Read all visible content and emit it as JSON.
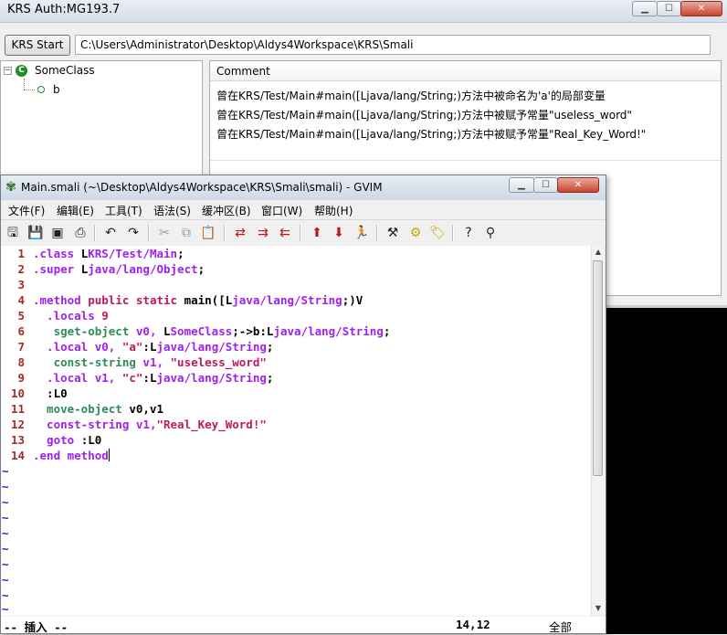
{
  "window": {
    "title": "KRS Auth:MG193.7"
  },
  "toolbar": {
    "start_label": "KRS Start",
    "path_value": "C:\\Users\\Administrator\\Desktop\\Aldys4Workspace\\KRS\\Smali"
  },
  "tree": {
    "class_icon_glyph": "C",
    "class_name": "SomeClass",
    "field_name": "b"
  },
  "comments": {
    "header": "Comment",
    "rows": [
      "曾在KRS/Test/Main#main([Ljava/lang/String;)方法中被命名为'a'的局部变量",
      "曾在KRS/Test/Main#main([Ljava/lang/String;)方法中被赋予常量\"useless_word\"",
      "曾在KRS/Test/Main#main([Ljava/lang/String;)方法中被赋予常量\"Real_Key_Word!\""
    ]
  },
  "gvim": {
    "title": "Main.smali (~\\Desktop\\Aldys4Workspace\\KRS\\Smali\\smali) - GVIM",
    "menu": [
      "文件(F)",
      "编辑(E)",
      "工具(T)",
      "语法(S)",
      "缓冲区(B)",
      "窗口(W)",
      "帮助(H)"
    ],
    "toolbar_icons": [
      "open-icon",
      "save-icon",
      "save-all-icon",
      "print-icon",
      "undo-icon",
      "redo-icon",
      "cut-icon",
      "copy-icon",
      "paste-icon",
      "find-replace-icon",
      "find-next-icon",
      "find-prev-icon",
      "load-session-icon",
      "save-session-icon",
      "run-script-icon",
      "make-icon",
      "run-ctags-icon",
      "jump-tag-icon",
      "help-icon",
      "find-help-icon"
    ],
    "line_numbers": [
      "1",
      "2",
      "3",
      "4",
      "5",
      "6",
      "7",
      "8",
      "9",
      "10",
      "11",
      "12",
      "13",
      "14"
    ],
    "code": {
      "l1": [
        ".class ",
        "L",
        "KRS/Test/Main",
        ";"
      ],
      "l2": [
        ".super ",
        "L",
        "java/lang/Object",
        ";"
      ],
      "l4": [
        ".method ",
        "public static ",
        "main([",
        "L",
        "java/lang/String",
        ";)V"
      ],
      "l5": [
        "  .locals ",
        "9"
      ],
      "l6": [
        "   sget-object ",
        "v0, ",
        "L",
        "SomeClass",
        ";->b:",
        "L",
        "java/lang/String",
        ";"
      ],
      "l7": [
        "  .local ",
        "v0, ",
        "\"a\"",
        ":",
        "L",
        "java/lang/String",
        ";"
      ],
      "l8": [
        "   const-string ",
        "v1, ",
        "\"useless_word\""
      ],
      "l9": [
        "  .local ",
        "v1, ",
        "\"c\"",
        ":",
        "L",
        "java/lang/String",
        ";"
      ],
      "l10": [
        "  :L0"
      ],
      "l11": [
        "  move-object ",
        "v0,v1"
      ],
      "l12": [
        "  const-string ",
        "v1,",
        "\"Real_Key_Word!\""
      ],
      "l13": [
        "  goto ",
        ":L0"
      ],
      "l14": [
        ".end method"
      ]
    },
    "tilde": "~",
    "status": {
      "mode": "-- 插入 --",
      "position": "14,12",
      "scroll": "全部"
    }
  }
}
